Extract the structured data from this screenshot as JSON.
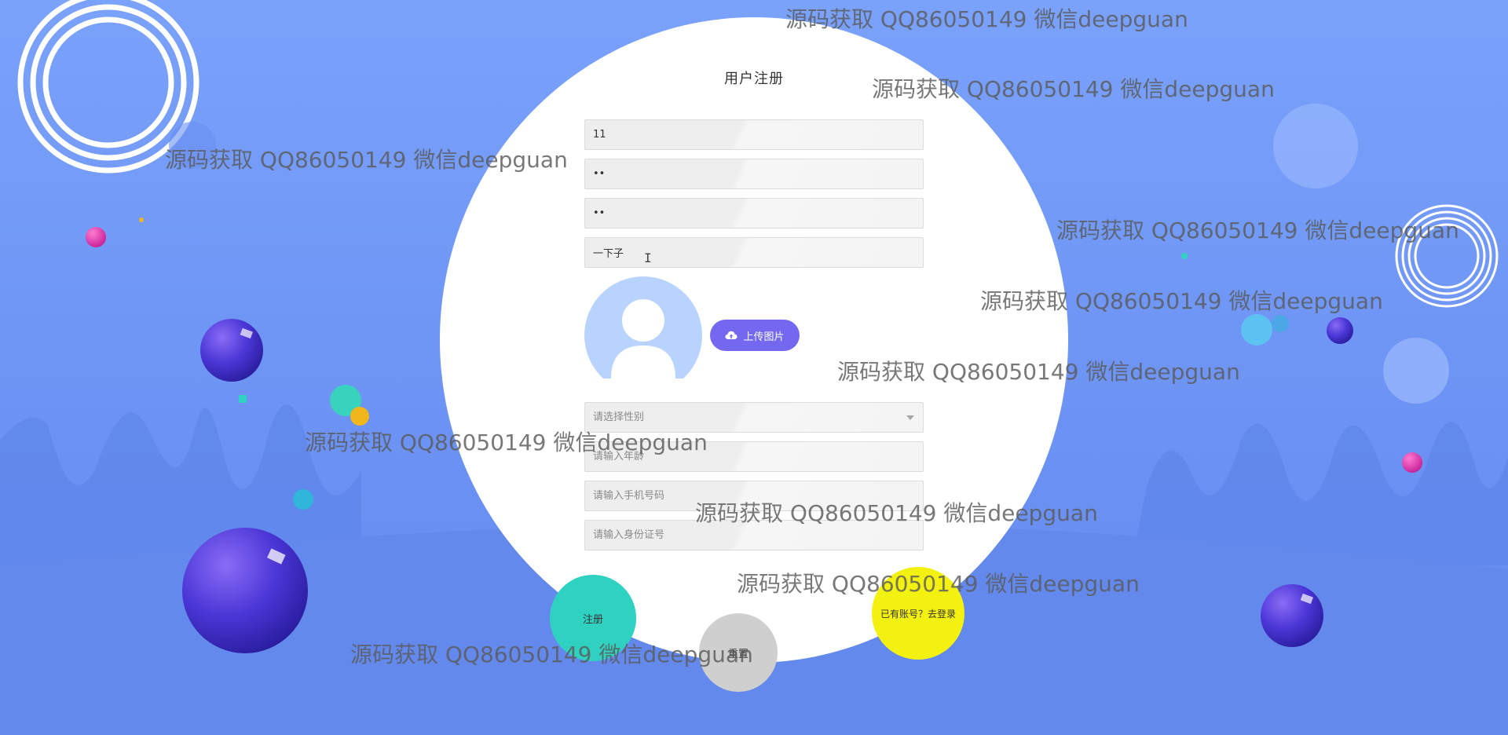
{
  "form": {
    "title": "用户注册",
    "fields": [
      {
        "value": "11",
        "placeholder": ""
      },
      {
        "value": "••",
        "placeholder": ""
      },
      {
        "value": "••",
        "placeholder": ""
      },
      {
        "value": "一下子",
        "placeholder": ""
      }
    ],
    "upload_label": "上传图片",
    "gender_placeholder": "请选择性别",
    "age_placeholder": "请输入年龄",
    "phone_placeholder": "请输入手机号码",
    "id_placeholder": "请输入身份证号",
    "register_label": "注册",
    "reset_label": "重置",
    "login_label": "已有账号？去登录"
  },
  "watermark": "源码获取 QQ86050149 微信deepguan",
  "icons": {
    "upload": "cloud-upload-icon",
    "avatar": "user-avatar-icon",
    "select_arrow": "chevron-down-icon",
    "cursor": "text-cursor-icon"
  },
  "colors": {
    "background": "#6f96f5",
    "card": "#ffffff",
    "upload_button": "#7468f0",
    "register_button": "#2fd2c0",
    "reset_button": "#cfcfcf",
    "login_button": "#f3f10f"
  }
}
